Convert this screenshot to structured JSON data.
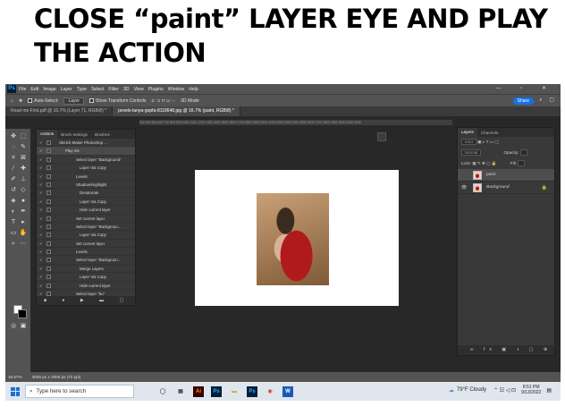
{
  "headline": "CLOSE “paint” LAYER EYE AND PLAY THE ACTION",
  "menu": [
    "File",
    "Edit",
    "Image",
    "Layer",
    "Type",
    "Select",
    "Filter",
    "3D",
    "View",
    "Plugins",
    "Window",
    "Help"
  ],
  "options": {
    "auto_select": "Auto-Select:",
    "auto_select_value": "Layer",
    "show_transform": "Show Transform Controls",
    "mode_3d": "3D Mode:",
    "share": "Share"
  },
  "doc_tabs": [
    "Read me First.pdf @ 16.7% (Layer 71, RGB/8) *",
    "pexels-lanya-gopfa-8118648.jpg @ 16.7% (paint, RGB/8) *"
  ],
  "ruler_text": "300 400 500 600 700 800 900 1000 1100 1200 1300 1400 1500 1600 1700 1800 1900 2000 2100 2200 2300 2400 2500 2600 2700 2800 2900 3000 3100 3200",
  "actions_panel": {
    "tabs": [
      "Actions",
      "Brush Settings",
      "Brushes"
    ],
    "rows": [
      {
        "text": "Sketch Maker Photoshop ...",
        "indent": 25,
        "type": "set"
      },
      {
        "text": "Play me",
        "indent": 32,
        "type": "action"
      },
      {
        "text": "Select layer \"Background\"",
        "indent": 44,
        "type": "step"
      },
      {
        "text": "Layer Via Copy",
        "indent": 48,
        "type": "step"
      },
      {
        "text": "Levels",
        "indent": 44,
        "type": "step"
      },
      {
        "text": "Shadow/Highlight",
        "indent": 44,
        "type": "step"
      },
      {
        "text": "Desaturate",
        "indent": 48,
        "type": "step"
      },
      {
        "text": "Layer Via Copy",
        "indent": 48,
        "type": "step"
      },
      {
        "text": "Hide current layer",
        "indent": 48,
        "type": "step"
      },
      {
        "text": "Set current layer",
        "indent": 44,
        "type": "step"
      },
      {
        "text": "Select layer \"Backgroun...",
        "indent": 44,
        "type": "step"
      },
      {
        "text": "Layer Via Copy",
        "indent": 48,
        "type": "step"
      },
      {
        "text": "Set current layer",
        "indent": 44,
        "type": "step"
      },
      {
        "text": "Levels",
        "indent": 44,
        "type": "step"
      },
      {
        "text": "Select layer \"Backgroun...",
        "indent": 44,
        "type": "step"
      },
      {
        "text": "Merge Layers",
        "indent": 48,
        "type": "step"
      },
      {
        "text": "Layer Via Copy",
        "indent": 48,
        "type": "step"
      },
      {
        "text": "Hide current layer",
        "indent": 48,
        "type": "step"
      },
      {
        "text": "Select layer \"bu\"",
        "indent": 44,
        "type": "step"
      }
    ]
  },
  "layers_panel": {
    "tabs": [
      "Layers",
      "Channels"
    ],
    "kind": "Kind",
    "blend": "Normal",
    "opacity_label": "Opacity:",
    "lock_label": "Lock:",
    "fill_label": "Fill:",
    "layers": [
      {
        "name": "paint",
        "selected": true,
        "visible": false
      },
      {
        "name": "Background",
        "selected": false,
        "visible": true
      }
    ],
    "footer_icons": "∞ fx ▣ ◑ ▢ ⊕ ☒"
  },
  "status": {
    "zoom": "16.67%",
    "size": "3000 px x 2000 px (72 ppi)"
  },
  "taskbar": {
    "search_placeholder": "Type here to search",
    "weather": "79°F  Cloudy",
    "time": "8:51 PM",
    "date": "9/13/2022"
  }
}
